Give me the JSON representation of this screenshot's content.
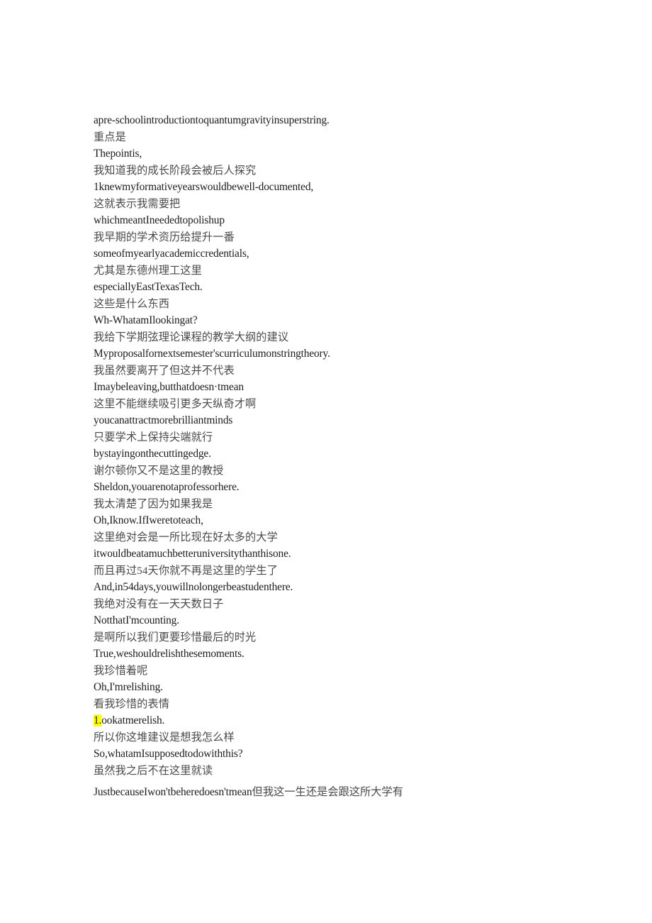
{
  "document": {
    "background_color": "#ffffff",
    "text_color": "#1c1c1c",
    "secondary_text_color": "#4a4a4a",
    "highlight_color": "#ffff00",
    "lines": [
      {
        "id": 1,
        "lang": "en",
        "text": "apre-schoolintroductiontoquantumgravityinsuperstring."
      },
      {
        "id": 2,
        "lang": "zh",
        "text": "重点是"
      },
      {
        "id": 3,
        "lang": "en",
        "text": "Thepointis,"
      },
      {
        "id": 4,
        "lang": "zh",
        "text": "我知道我的成长阶段会被后人探究"
      },
      {
        "id": 5,
        "lang": "en",
        "text": "1knewmyformativeyearswouldbewell-documented,"
      },
      {
        "id": 6,
        "lang": "zh",
        "text": "这就表示我需要把"
      },
      {
        "id": 7,
        "lang": "en",
        "text": "whichmeantIneededtopolishup"
      },
      {
        "id": 8,
        "lang": "zh",
        "text": "我早期的学术资历给提升一番"
      },
      {
        "id": 9,
        "lang": "en",
        "text": "someofmyearlyacademiccredentials,"
      },
      {
        "id": 10,
        "lang": "zh",
        "text": "尤其是东德州理工这里"
      },
      {
        "id": 11,
        "lang": "en",
        "text": "especiallyEastTexasTech."
      },
      {
        "id": 12,
        "lang": "zh",
        "text": "这些是什么东西"
      },
      {
        "id": 13,
        "lang": "en",
        "text": "Wh-WhatamIlookingat?"
      },
      {
        "id": 14,
        "lang": "zh",
        "text": "我给下学期弦理论课程的教学大纲的建议"
      },
      {
        "id": 15,
        "lang": "en",
        "text": "Myproposalfornextsemester'scurriculumonstringtheory."
      },
      {
        "id": 16,
        "lang": "zh",
        "text": "我虽然要离开了但这并不代表"
      },
      {
        "id": 17,
        "lang": "en",
        "text": "Imaybeleaving,butthatdoesn·tmean"
      },
      {
        "id": 18,
        "lang": "zh",
        "text": "这里不能继续吸引更多天纵奇才啊"
      },
      {
        "id": 19,
        "lang": "en",
        "text": "youcanattractmorebrilliantminds"
      },
      {
        "id": 20,
        "lang": "zh",
        "text": "只要学术上保持尖端就行"
      },
      {
        "id": 21,
        "lang": "en",
        "text": "bystayingonthecuttingedge."
      },
      {
        "id": 22,
        "lang": "zh",
        "text": "谢尔顿你又不是这里的教授"
      },
      {
        "id": 23,
        "lang": "en",
        "text": "Sheldon,youarenotaprofessorhere."
      },
      {
        "id": 24,
        "lang": "zh",
        "text": "我太清楚了因为如果我是"
      },
      {
        "id": 25,
        "lang": "en",
        "text": "Oh,Iknow.IfIweretoteach,"
      },
      {
        "id": 26,
        "lang": "zh",
        "text": "这里绝对会是一所比现在好太多的大学"
      },
      {
        "id": 27,
        "lang": "en",
        "text": "itwouldbeatamuchbetteruniversitythanthisone."
      },
      {
        "id": 28,
        "lang": "zh",
        "text": "而且再过54天你就不再是这里的学生了"
      },
      {
        "id": 29,
        "lang": "en",
        "text": "And,in54days,youwillnolongerbeastudenthere."
      },
      {
        "id": 30,
        "lang": "zh",
        "text": "我绝对没有在一天天数日子"
      },
      {
        "id": 31,
        "lang": "en",
        "text": "NotthatI'mcounting."
      },
      {
        "id": 32,
        "lang": "zh",
        "text": "是啊所以我们更要珍惜最后的时光"
      },
      {
        "id": 33,
        "lang": "en",
        "text": "True,weshouldrelishthesemoments."
      },
      {
        "id": 34,
        "lang": "zh",
        "text": "我珍惜着呢"
      },
      {
        "id": 35,
        "lang": "en",
        "text": "Oh,I'mrelishing."
      },
      {
        "id": 36,
        "lang": "zh",
        "text": "看我珍惜的表情"
      },
      {
        "id": 37,
        "lang": "en",
        "highlight": {
          "prefix": "1.",
          "rest": "ookatmerelish."
        },
        "text": "1.ookatmerelish."
      },
      {
        "id": 38,
        "lang": "zh",
        "text": "所以你这堆建议是想我怎么样"
      },
      {
        "id": 39,
        "lang": "en",
        "text": "So,whatamIsupposedtodowiththis?"
      },
      {
        "id": 40,
        "lang": "zh",
        "text": "虽然我之后不在这里就读"
      },
      {
        "id": 41,
        "lang": "mixed",
        "latin": "JustbecauseIwon'tbeheredoesn'tmean",
        "cjk": "但我这一生还是会跟这所大学有",
        "text": "JustbecauseIwon'tbeheredoesn'tmean但我这一生还是会跟这所大学有"
      }
    ]
  }
}
